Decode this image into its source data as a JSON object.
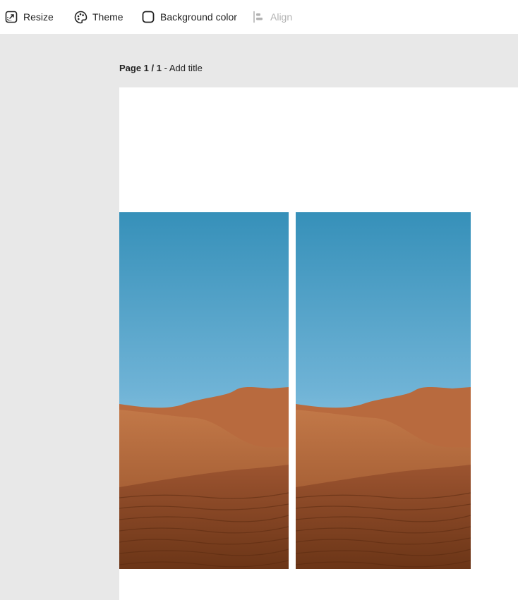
{
  "toolbar": {
    "resize_label": "Resize",
    "theme_label": "Theme",
    "background_label": "Background color",
    "align_label": "Align",
    "align_disabled": true
  },
  "page": {
    "indicator": "Page 1 / 1",
    "separator": " - ",
    "title_placeholder": "Add title"
  },
  "canvas": {
    "background": "#ffffff",
    "images": [
      {
        "name": "desert-dunes-image-left",
        "subject": "desert dunes under blue sky"
      },
      {
        "name": "desert-dunes-image-right",
        "subject": "desert dunes under blue sky"
      }
    ]
  },
  "colors": {
    "workspace_bg": "#e8e8e8",
    "toolbar_bg": "#ffffff",
    "text": "#222222",
    "disabled_text": "#b2b2b2",
    "sky_top": "#3690b9",
    "sky_bottom": "#c8e6f3",
    "sand_light": "#b86a3e",
    "sand_dark": "#6b3517"
  }
}
